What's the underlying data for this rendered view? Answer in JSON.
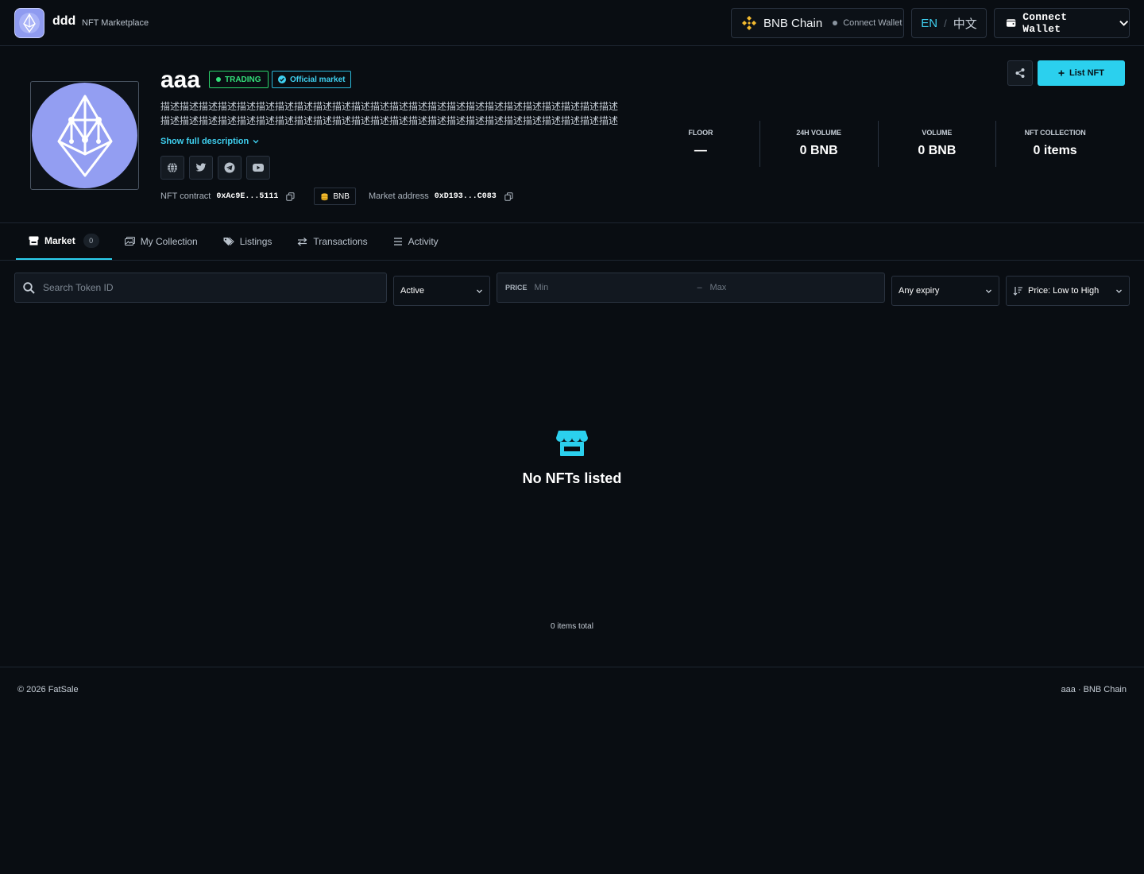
{
  "header": {
    "brand_name": "ddd",
    "brand_sub": "NFT Marketplace",
    "chain_name": "BNB Chain",
    "chain_status": "Connect Wallet",
    "lang_en": "EN",
    "lang_sep": "/",
    "lang_zh": "中文",
    "wallet_button": "Connect Wallet"
  },
  "collection": {
    "title": "aaa",
    "badge_trading": "TRADING",
    "badge_official": "Official market",
    "description": "描述描述描述描述描述描述描述描述描述描述描述描述描述描述描述描述描述描述描述描述描述描述描述描述描述描述描述描述描述描述描述描述描述描述描述描述描述描述描述描述描述描述描述描述描述描述描述描述描述描述描述描述描述描述描述描述描述描述描述描…",
    "show_more": "Show full description",
    "nft_contract_label": "NFT contract",
    "nft_contract_value": "0xAc9E...5111",
    "currency": "BNB",
    "market_address_label": "Market address",
    "market_address_value": "0xD193...C083",
    "list_button": "List NFT"
  },
  "stats": [
    {
      "label": "FLOOR",
      "value": "—"
    },
    {
      "label": "24H VOLUME",
      "value": "0 BNB"
    },
    {
      "label": "VOLUME",
      "value": "0 BNB"
    },
    {
      "label": "NFT COLLECTION",
      "value": "0 items"
    }
  ],
  "tabs": [
    {
      "label": "Market",
      "count": "0",
      "icon": "store-icon"
    },
    {
      "label": "My Collection",
      "icon": "images-icon"
    },
    {
      "label": "Listings",
      "icon": "tags-icon"
    },
    {
      "label": "Transactions",
      "icon": "exchange-icon"
    },
    {
      "label": "Activity",
      "icon": "list-icon"
    }
  ],
  "filters": {
    "search_placeholder": "Search Token ID",
    "status": "Active",
    "price_label": "PRICE",
    "price_min_placeholder": "Min",
    "price_dash": "–",
    "price_max_placeholder": "Max",
    "expiry": "Any expiry",
    "sort": "Price: Low to High"
  },
  "empty": {
    "message": "No NFTs listed",
    "total": "0 items total"
  },
  "footer": {
    "left": "© 2026 FatSale",
    "right": "aaa · BNB Chain"
  },
  "colors": {
    "accent": "#2bd0ee",
    "trading": "#34e07a",
    "background": "#090d12",
    "avatar": "#939ef2",
    "bnb": "#f3ba2f"
  }
}
